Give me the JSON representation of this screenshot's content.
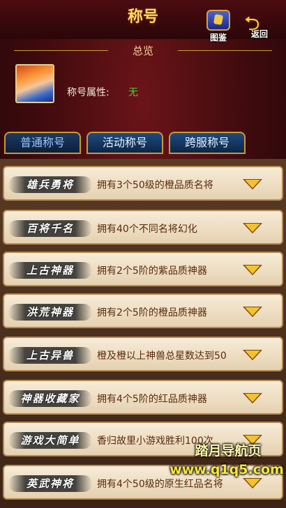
{
  "header": {
    "title": "称号",
    "atlas_label": "图鉴",
    "back_label": "返回"
  },
  "overview": {
    "title": "总览",
    "attr_label": "称号属性:",
    "attr_value": "无"
  },
  "tabs": [
    {
      "label": "普通称号",
      "active": true
    },
    {
      "label": "活动称号",
      "active": false
    },
    {
      "label": "跨服称号",
      "active": false
    }
  ],
  "titles": [
    {
      "badge": "雄兵勇将",
      "desc": "拥有3个50级的橙品质名将"
    },
    {
      "badge": "百将千名",
      "desc": "拥有40个不同名将幻化"
    },
    {
      "badge": "上古神器",
      "desc": "拥有2个5阶的紫品质神器"
    },
    {
      "badge": "洪荒神器",
      "desc": "拥有2个5阶的橙品质神器"
    },
    {
      "badge": "上古异兽",
      "desc": "橙及橙以上神兽总星数达到50"
    },
    {
      "badge": "神器收藏家",
      "desc": "拥有4个5阶的红品质神器"
    },
    {
      "badge": "游戏大简单",
      "desc": "香归故里小游戏胜利100次"
    },
    {
      "badge": "英武神将",
      "desc": "拥有4个50级的原生红品名将"
    }
  ],
  "watermark": {
    "text": "踏月导航页",
    "url": "www.q1q5.com"
  }
}
